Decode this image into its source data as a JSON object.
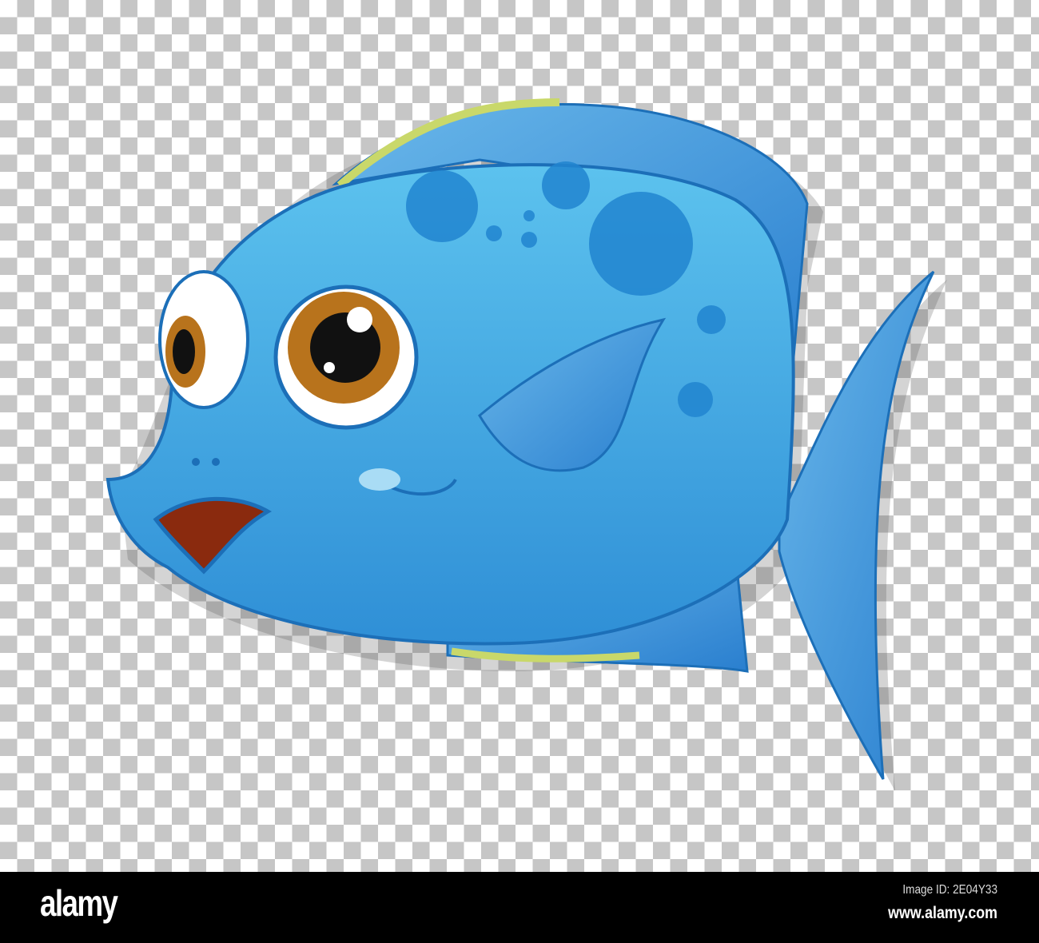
{
  "footer": {
    "logo": "alamy",
    "image_id": "Image ID: 2E04Y33",
    "url": "www.alamy.com"
  },
  "watermark": "alamy",
  "colors": {
    "body": "#4fb3e6",
    "spots": "#2185d0",
    "outline": "#1c6fb8",
    "fin_edge": "#c9d86a",
    "eye_iris": "#b8731c",
    "mouth": "#8a2a0e",
    "checker": "#c6c6c6"
  }
}
